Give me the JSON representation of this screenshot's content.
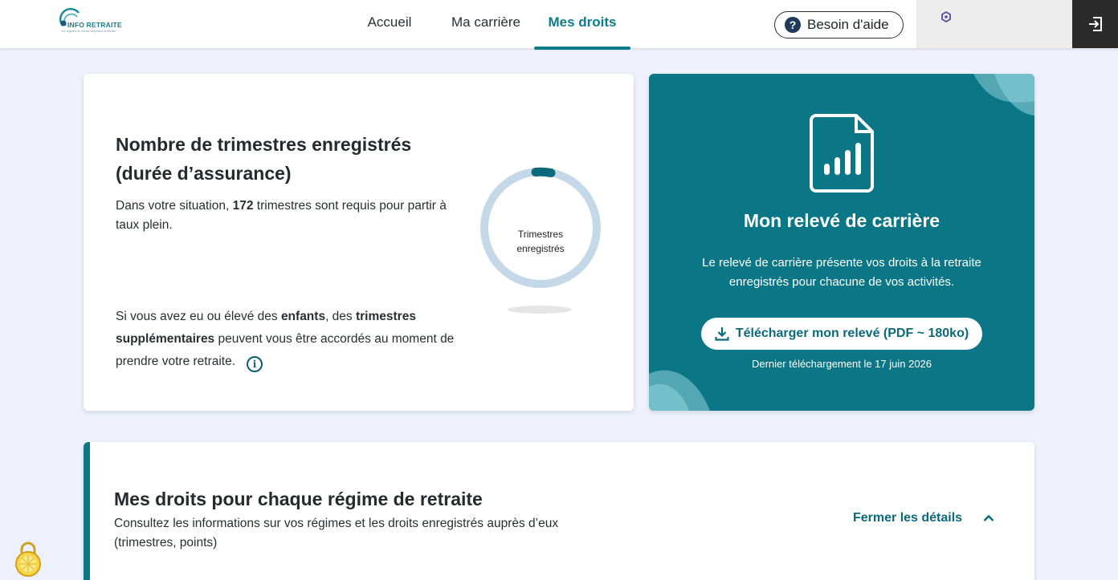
{
  "header": {
    "logo_text": "INFO RETRAITE",
    "logo_subtext": "Vos régimes de retraite simplifient la retraite",
    "nav": [
      {
        "label": "Accueil",
        "active": false
      },
      {
        "label": "Ma carrière",
        "active": false
      },
      {
        "label": "Mes droits",
        "active": true
      }
    ],
    "help_label": "Besoin d'aide",
    "help_icon": "question-circle-icon",
    "logout_icon": "logout-icon"
  },
  "trimestres_card": {
    "title_line1": "Nombre de trimestres enregistrés",
    "title_line2": "(durée d’assurance)",
    "text1_a": "Dans votre situation, ",
    "text1_b": "172",
    "text1_c": " trimestres sont requis pour partir à taux plein.",
    "text2_a": "Si vous avez eu ou élevé des ",
    "text2_b": "enfants",
    "text2_c": ", des ",
    "text2_d": "trimestres supplémentaires",
    "text2_e": " peuvent vous être accordés au moment de prendre votre retraite.",
    "donut_line1": "Trimestres",
    "donut_line2": "enregistrés",
    "donut_color": "#c5d8e8",
    "donut_marker_color": "#0b6a7a"
  },
  "releve_card": {
    "title": "Mon relevé de carrière",
    "description": "Le relevé de carrière présente vos droits à la retraite enregistrés pour chacune de vos activités.",
    "download_label": "Télécharger mon relevé (PDF ~ 180ko)",
    "last_download": "Dernier téléchargement le 17 juin 2026",
    "background": "#0b7685"
  },
  "regimes_card": {
    "title": "Mes droits pour chaque régime de retraite",
    "description": "Consultez les informations sur vos régimes et les droits enregistrés auprès d’eux (trimestres, points)",
    "toggle_label": "Fermer les détails"
  }
}
